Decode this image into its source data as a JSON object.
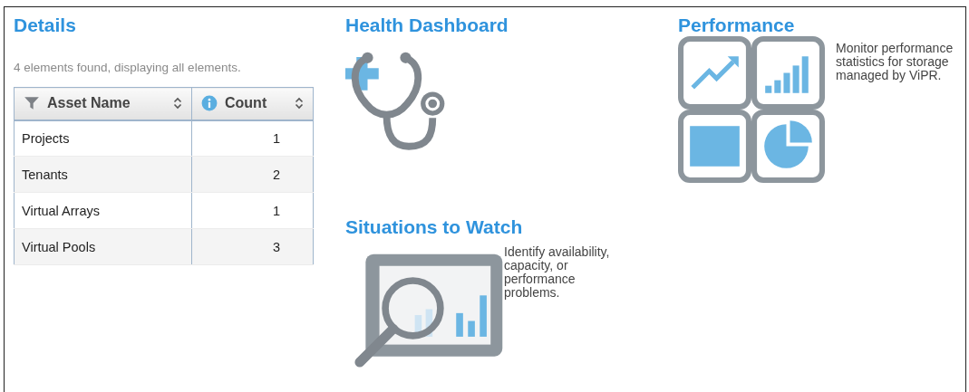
{
  "details": {
    "title": "Details",
    "summary": "4 elements found, displaying all elements.",
    "table": {
      "columns": [
        {
          "label": "Asset Name",
          "kind": "filter"
        },
        {
          "label": "Count",
          "kind": "info"
        }
      ],
      "rows": [
        {
          "name": "Projects",
          "count": "1"
        },
        {
          "name": "Tenants",
          "count": "2"
        },
        {
          "name": "Virtual Arrays",
          "count": "1"
        },
        {
          "name": "Virtual Pools",
          "count": "3"
        }
      ]
    }
  },
  "health": {
    "title": "Health Dashboard"
  },
  "situations": {
    "title": "Situations to Watch",
    "description": "Identify availability, capacity, or performance problems."
  },
  "performance": {
    "title": "Performance",
    "description": "Monitor performance statistics for storage managed by ViPR."
  }
}
